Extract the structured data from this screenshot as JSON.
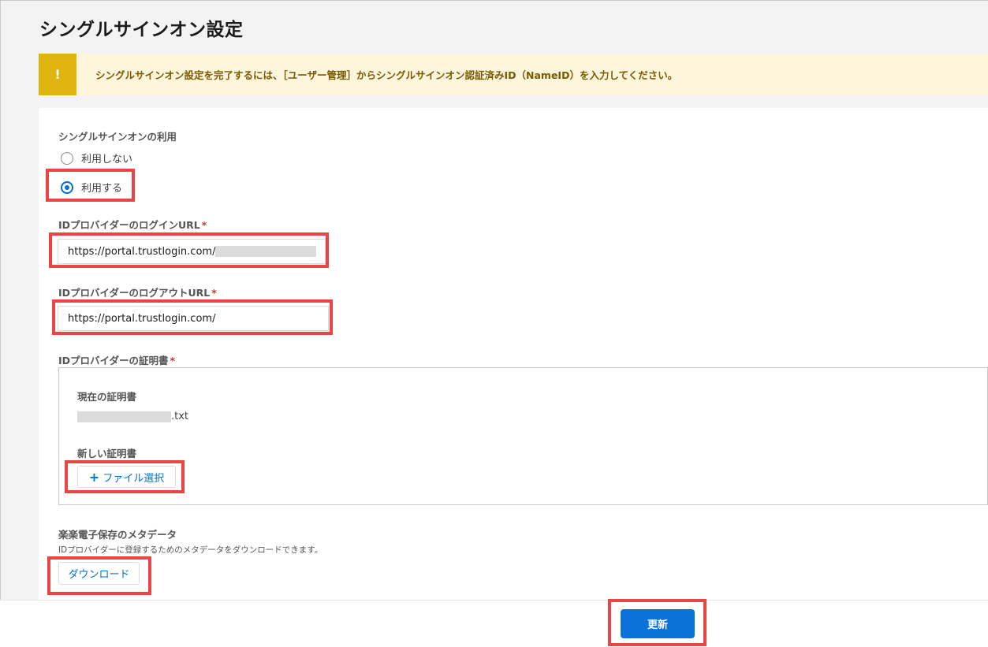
{
  "page": {
    "title": "シングルサインオン設定"
  },
  "alert": {
    "icon": "!",
    "text": "シングルサインオン設定を完了するには、［ユーザー管理］からシングルサインオン認証済みID（NameID）を入力してください。"
  },
  "sso_usage": {
    "label": "シングルサインオンの利用",
    "options": [
      {
        "label": "利用しない",
        "checked": false
      },
      {
        "label": "利用する",
        "checked": true
      }
    ]
  },
  "login_url": {
    "label": "IDプロバイダーのログインURL",
    "required_mark": "*",
    "value": "https://portal.trustlogin.com/"
  },
  "logout_url": {
    "label": "IDプロバイダーのログアウトURL",
    "required_mark": "*",
    "value": "https://portal.trustlogin.com/"
  },
  "certificate": {
    "label": "IDプロバイダーの証明書",
    "required_mark": "*",
    "current_label": "現在の証明書",
    "current_file_suffix": ".txt",
    "new_label": "新しい証明書",
    "file_select_button": "ファイル選択"
  },
  "metadata": {
    "label": "楽楽電子保存のメタデータ",
    "description": "IDプロバイダーに登録するためのメタデータをダウンロードできます。",
    "download_button": "ダウンロード"
  },
  "footer": {
    "update_button": "更新"
  },
  "colors": {
    "primary": "#0a72d9",
    "alert_icon_bg": "#e0b40f",
    "alert_bg": "#fdf6dd",
    "highlight": "#e94545",
    "required": "#c23934"
  }
}
